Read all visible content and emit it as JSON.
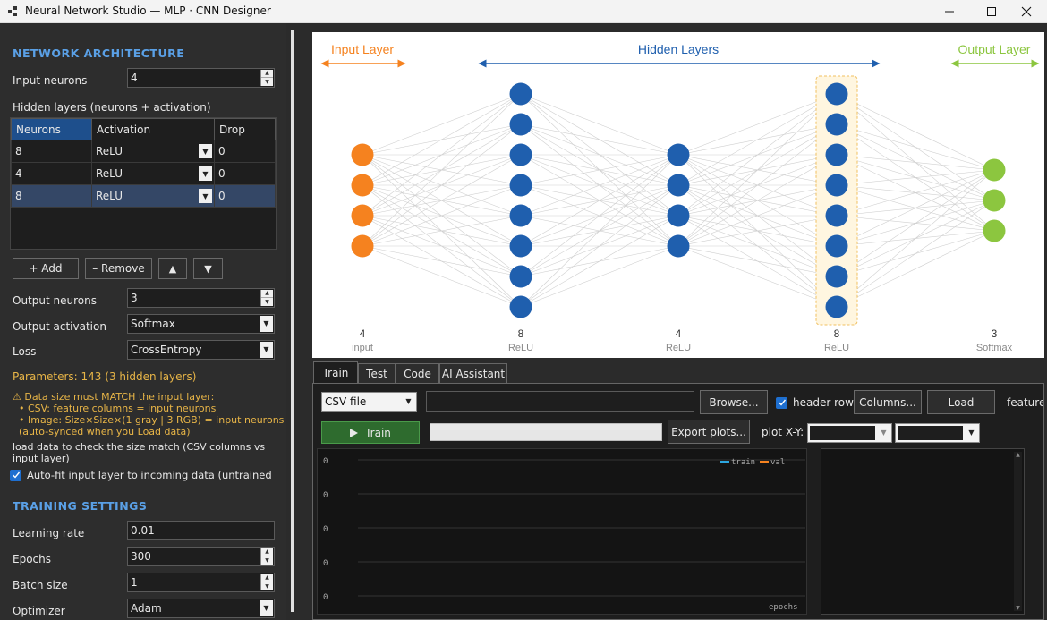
{
  "window": {
    "title": "Neural Network Studio — MLP · CNN Designer"
  },
  "architecture": {
    "section_title": "NETWORK  ARCHITECTURE",
    "input_neurons_label": "Input neurons",
    "input_neurons_value": "4",
    "hidden_layers_label": "Hidden layers  (neurons + activation)",
    "table": {
      "headers": [
        "Neurons",
        "Activation",
        "Drop"
      ],
      "rows": [
        {
          "neurons": "8",
          "activation": "ReLU",
          "drop": "0"
        },
        {
          "neurons": "4",
          "activation": "ReLU",
          "drop": "0"
        },
        {
          "neurons": "8",
          "activation": "ReLU",
          "drop": "0"
        }
      ],
      "selected_row": 2
    },
    "add_label": "+ Add",
    "remove_label": "– Remove",
    "move_up_label": "▲",
    "move_down_label": "▼",
    "output_neurons_label": "Output neurons",
    "output_neurons_value": "3",
    "output_activation_label": "Output activation",
    "output_activation_value": "Softmax",
    "loss_label": "Loss",
    "loss_value": "CrossEntropy",
    "parameters_text": "Parameters: 143   (3 hidden layers)",
    "warning_lines": [
      "⚠ Data size must MATCH the input layer:",
      "  • CSV: feature columns = input neurons",
      "  • Image: Size×Size×(1 gray | 3 RGB) = input neurons",
      "  (auto-synced when you Load data)"
    ],
    "load_note": "load data to check the size match (CSV columns vs input layer)",
    "autofit_label": "Auto-fit input layer to incoming data (untrained"
  },
  "training": {
    "section_title": "TRAINING  SETTINGS",
    "learning_rate_label": "Learning rate",
    "learning_rate_value": "0.01",
    "epochs_label": "Epochs",
    "epochs_value": "300",
    "batch_size_label": "Batch size",
    "batch_size_value": "1",
    "optimizer_label": "Optimizer",
    "optimizer_value": "Adam"
  },
  "diagram": {
    "input_header": "Input Layer",
    "hidden_header": "Hidden Layers",
    "output_header": "Output Layer",
    "colors": {
      "input": "#f5821f",
      "hidden": "#1f5fae",
      "output": "#8cc63f",
      "edge": "#cfcfcf"
    },
    "layers": [
      {
        "count": 4,
        "count_label": "4",
        "activation": "input",
        "role": "input"
      },
      {
        "count": 8,
        "count_label": "8",
        "activation": "ReLU",
        "role": "hidden"
      },
      {
        "count": 4,
        "count_label": "4",
        "activation": "ReLU",
        "role": "hidden"
      },
      {
        "count": 8,
        "count_label": "8",
        "activation": "ReLU",
        "role": "hidden",
        "highlighted": true
      },
      {
        "count": 3,
        "count_label": "3",
        "activation": "Softmax",
        "role": "output"
      }
    ]
  },
  "tabs": [
    "Train",
    "Test",
    "Code",
    "AI Assistant"
  ],
  "active_tab": "Train",
  "train_panel": {
    "source_value": "CSV file",
    "path_value": "",
    "browse_label": "Browse...",
    "header_row_label": "header row",
    "columns_label": "Columns...",
    "load_label": "Load",
    "features_label": "feature",
    "train_label": "Train",
    "export_label": "Export plots...",
    "plot_xy_label": "plot X-Y:",
    "plot_x_value": "",
    "plot_y_value": "",
    "plot": {
      "legend": [
        "train",
        "val"
      ],
      "legend_colors": [
        "#2ca6e0",
        "#f5821f"
      ],
      "y_ticks": [
        "0",
        "0",
        "0",
        "0",
        "0"
      ],
      "xlabel": "epochs"
    }
  }
}
